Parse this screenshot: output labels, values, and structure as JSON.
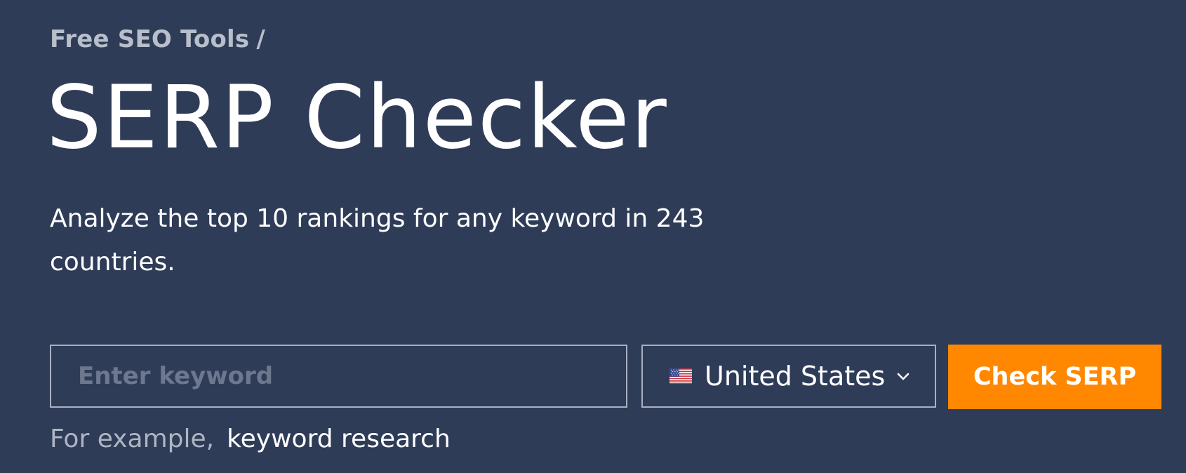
{
  "breadcrumb": {
    "parent_label": "Free SEO Tools",
    "separator": "/"
  },
  "page": {
    "title": "SERP Checker",
    "subtitle": "Analyze the top 10 rankings for any keyword in 243 countries."
  },
  "form": {
    "keyword_placeholder": "Enter keyword",
    "keyword_value": "",
    "country": {
      "selected": "United States",
      "flag_icon": "us-flag-icon",
      "chevron_icon": "chevron-down-icon"
    },
    "submit_label": "Check SERP"
  },
  "example": {
    "label": "For example,",
    "keyword": "keyword research"
  },
  "colors": {
    "background": "#2f3c58",
    "accent": "#ff8800",
    "border": "#a8b0bf",
    "muted_text": "#b8bfca"
  }
}
